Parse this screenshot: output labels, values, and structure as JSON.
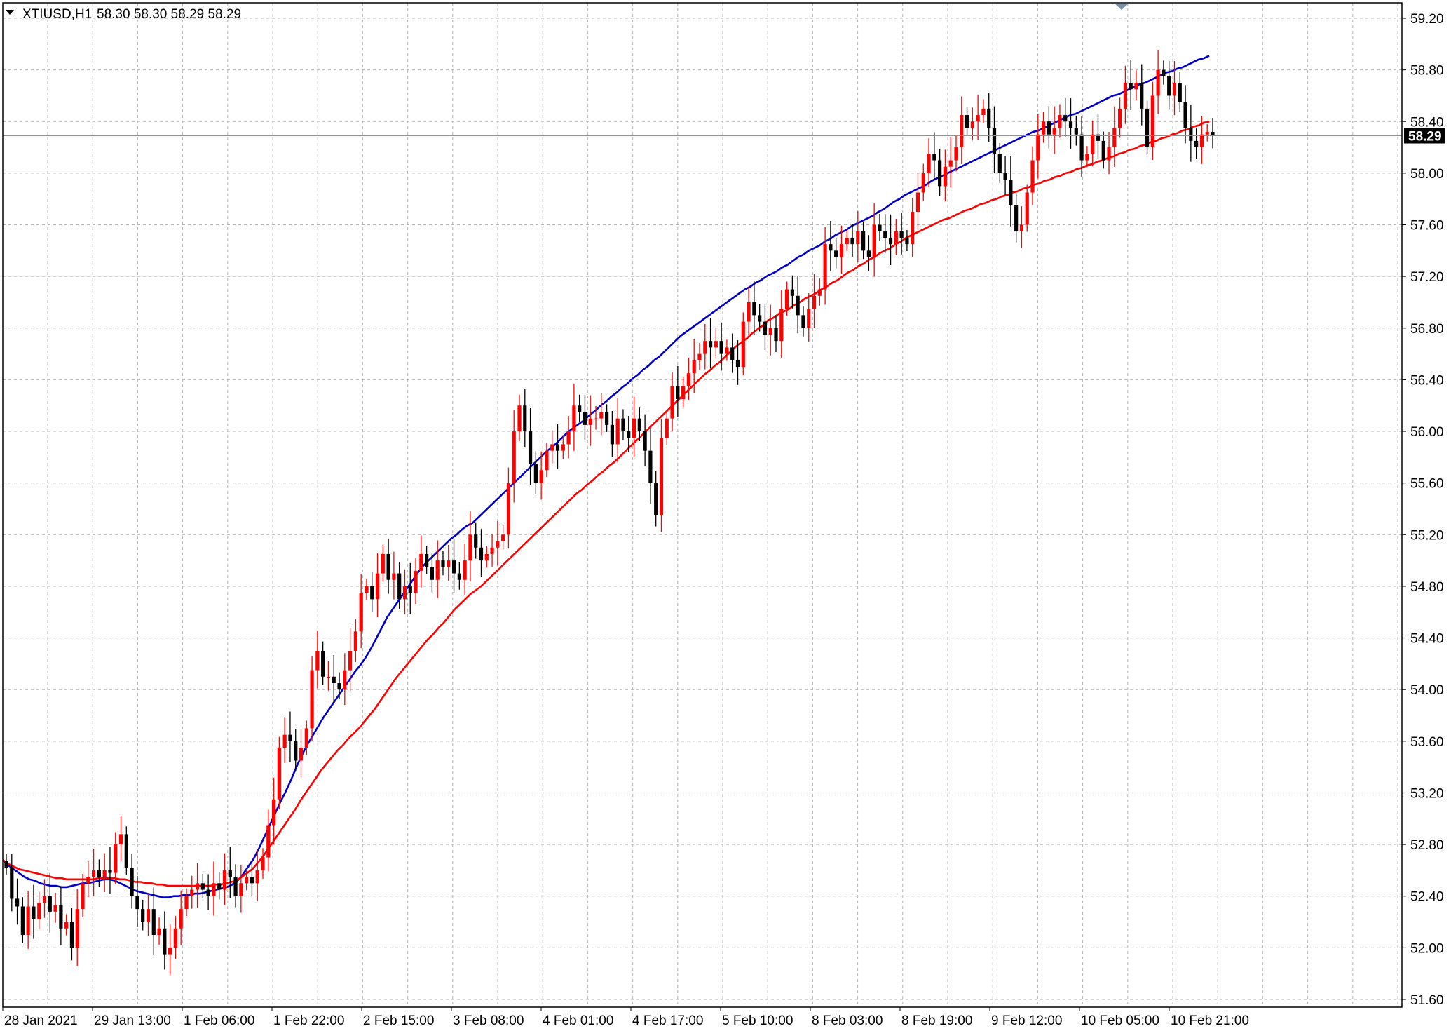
{
  "header": {
    "symbol": "XTIUSD,H1",
    "ohlc": "58.30 58.30 58.29 58.29",
    "collapse_icon": "triangle-down-icon"
  },
  "colors": {
    "background": "#ffffff",
    "grid": "#b4b4b4",
    "bull_candle": "#ff0000",
    "bear_candle": "#000000",
    "ma_fast": "#0000c8",
    "ma_slow": "#ff0000",
    "bid_line": "#8090b0",
    "price_tag_bg": "#000000"
  },
  "current_price_label": "58.29",
  "chart_data": {
    "type": "candlestick",
    "title": "XTIUSD,H1",
    "y_ticks": [
      "59.20",
      "58.80",
      "58.40",
      "58.00",
      "57.60",
      "57.20",
      "56.80",
      "56.40",
      "56.00",
      "55.60",
      "55.20",
      "54.80",
      "54.40",
      "54.00",
      "53.60",
      "53.20",
      "52.80",
      "52.40",
      "52.00",
      "51.60"
    ],
    "x_ticks": [
      "28 Jan 2021",
      "29 Jan 13:00",
      "1 Feb 06:00",
      "1 Feb 22:00",
      "2 Feb 15:00",
      "3 Feb 08:00",
      "4 Feb 01:00",
      "4 Feb 17:00",
      "5 Feb 10:00",
      "8 Feb 03:00",
      "8 Feb 19:00",
      "9 Feb 12:00",
      "10 Feb 05:00",
      "10 Feb 21:00"
    ],
    "ylim": [
      51.45,
      59.3
    ],
    "grid": true,
    "last_price": 58.29,
    "close": [
      52.62,
      52.38,
      52.32,
      52.1,
      52.32,
      52.22,
      52.35,
      52.4,
      52.28,
      52.33,
      52.15,
      52.2,
      52.0,
      52.3,
      52.5,
      52.55,
      52.6,
      52.55,
      52.6,
      52.58,
      52.8,
      52.88,
      52.62,
      52.4,
      52.3,
      52.2,
      52.3,
      52.1,
      52.15,
      51.95,
      52.0,
      52.15,
      52.3,
      52.4,
      52.45,
      52.5,
      52.45,
      52.4,
      52.5,
      52.45,
      52.6,
      52.55,
      52.4,
      52.5,
      52.55,
      52.5,
      52.6,
      52.7,
      52.95,
      53.15,
      53.55,
      53.65,
      53.6,
      53.45,
      53.55,
      53.7,
      54.15,
      54.3,
      54.1,
      54.1,
      54.05,
      54.0,
      54.15,
      54.3,
      54.45,
      54.75,
      54.8,
      54.7,
      54.9,
      55.05,
      54.85,
      54.9,
      54.7,
      54.8,
      54.75,
      54.92,
      55.05,
      54.95,
      54.85,
      55.0,
      54.95,
      55.0,
      54.9,
      54.85,
      55.0,
      55.2,
      55.1,
      55.0,
      55.05,
      55.1,
      55.15,
      55.2,
      55.6,
      56.0,
      56.2,
      56.0,
      55.75,
      55.6,
      55.7,
      55.85,
      55.9,
      55.85,
      55.9,
      56.0,
      56.2,
      56.15,
      56.05,
      56.1,
      56.1,
      56.15,
      56.05,
      55.9,
      56.1,
      56.0,
      55.95,
      56.1,
      56.0,
      55.85,
      55.6,
      55.35,
      55.95,
      56.1,
      56.35,
      56.25,
      56.35,
      56.45,
      56.55,
      56.6,
      56.7,
      56.65,
      56.7,
      56.6,
      56.65,
      56.55,
      56.5,
      56.85,
      57.0,
      56.9,
      56.85,
      56.75,
      56.8,
      56.7,
      56.95,
      57.1,
      57.05,
      56.9,
      56.8,
      56.95,
      57.05,
      57.1,
      57.45,
      57.4,
      57.35,
      57.45,
      57.5,
      57.45,
      57.55,
      57.4,
      57.35,
      57.6,
      57.55,
      57.5,
      57.45,
      57.55,
      57.5,
      57.45,
      57.7,
      57.85,
      58.0,
      58.15,
      58.1,
      57.9,
      58.05,
      58.1,
      58.2,
      58.45,
      58.35,
      58.4,
      58.45,
      58.5,
      58.35,
      58.15,
      58.0,
      57.95,
      57.75,
      57.55,
      57.6,
      57.85,
      58.1,
      58.3,
      58.4,
      58.3,
      58.35,
      58.45,
      58.4,
      58.35,
      58.3,
      58.1,
      58.15,
      58.3,
      58.25,
      58.1,
      58.2,
      58.35,
      58.5,
      58.7,
      58.65,
      58.7,
      58.5,
      58.2,
      58.6,
      58.8,
      58.75,
      58.6,
      58.7,
      58.55,
      58.35,
      58.25,
      58.2,
      58.3,
      58.32,
      58.29
    ],
    "series": [
      {
        "values": [
          52.68,
          52.64,
          52.61,
          52.58,
          52.55,
          52.53,
          52.52,
          52.5,
          52.49,
          52.48,
          52.48,
          52.47,
          52.47,
          52.48,
          52.49,
          52.5,
          52.5,
          52.51,
          52.52,
          52.53,
          52.53,
          52.52,
          52.5,
          52.48,
          52.46,
          52.44,
          52.43,
          52.42,
          52.41,
          52.4,
          52.39,
          52.39,
          52.4,
          52.4,
          52.41,
          52.41,
          52.42,
          52.42,
          52.43,
          52.44,
          52.45,
          52.46,
          52.47,
          52.49,
          52.52,
          52.57,
          52.63,
          52.69,
          52.77,
          52.86,
          52.95,
          53.04,
          53.13,
          53.21,
          53.3,
          53.4,
          53.49,
          53.57,
          53.64,
          53.71,
          53.78,
          53.84,
          53.9,
          53.96,
          54.02,
          54.08,
          54.14,
          54.19,
          54.25,
          54.32,
          54.4,
          54.48,
          54.56,
          54.62,
          54.68,
          54.74,
          54.8,
          54.86,
          54.92,
          54.97,
          55.01,
          55.05,
          55.09,
          55.13,
          55.17,
          55.2,
          55.24,
          55.27,
          55.29,
          55.33,
          55.37,
          55.41,
          55.45,
          55.49,
          55.53,
          55.57,
          55.61,
          55.65,
          55.69,
          55.73,
          55.77,
          55.81,
          55.85,
          55.88,
          55.92,
          55.96,
          56.0,
          56.03,
          56.06,
          56.09,
          56.13,
          56.16,
          56.2,
          56.23,
          56.27,
          56.3,
          56.34,
          56.37,
          56.41,
          56.44,
          56.48,
          56.51,
          56.55,
          56.58,
          56.62,
          56.66,
          56.7,
          56.74,
          56.77,
          56.8,
          56.83,
          56.86,
          56.89,
          56.92,
          56.95,
          56.98,
          57.01,
          57.04,
          57.07,
          57.1,
          57.12,
          57.15,
          57.17,
          57.2,
          57.22,
          57.24,
          57.27,
          57.29,
          57.32,
          57.35,
          57.37,
          57.4,
          57.42,
          57.44,
          57.47,
          57.49,
          57.52,
          57.54,
          57.56,
          57.59,
          57.61,
          57.63,
          57.65,
          57.67,
          57.7,
          57.72,
          57.75,
          57.78,
          57.8,
          57.83,
          57.85,
          57.87,
          57.89,
          57.91,
          57.94,
          57.96,
          57.98,
          58.0,
          58.02,
          58.04,
          58.06,
          58.08,
          58.1,
          58.12,
          58.14,
          58.16,
          58.18,
          58.2,
          58.22,
          58.24,
          58.26,
          58.28,
          58.3,
          58.32,
          58.33,
          58.35,
          58.37,
          58.39,
          58.41,
          58.43,
          58.45,
          58.46,
          58.48,
          58.5,
          58.52,
          58.54,
          58.56,
          58.58,
          58.6,
          58.61,
          58.63,
          58.65,
          58.67,
          58.69,
          58.7,
          58.72,
          58.74,
          58.76,
          58.78,
          58.79,
          58.81,
          58.82,
          58.84,
          58.86,
          58.88,
          58.89,
          58.91
        ]
      },
      {
        "values": [
          52.68,
          52.65,
          52.63,
          52.61,
          52.6,
          52.59,
          52.58,
          52.57,
          52.56,
          52.55,
          52.54,
          52.54,
          52.53,
          52.53,
          52.53,
          52.53,
          52.53,
          52.53,
          52.54,
          52.54,
          52.54,
          52.54,
          52.53,
          52.53,
          52.52,
          52.51,
          52.51,
          52.5,
          52.5,
          52.49,
          52.49,
          52.48,
          52.48,
          52.48,
          52.48,
          52.48,
          52.48,
          52.48,
          52.48,
          52.48,
          52.49,
          52.49,
          52.5,
          52.51,
          52.52,
          52.55,
          52.58,
          52.61,
          52.66,
          52.71,
          52.77,
          52.83,
          52.89,
          52.95,
          53.01,
          53.07,
          53.14,
          53.2,
          53.26,
          53.32,
          53.38,
          53.43,
          53.48,
          53.53,
          53.57,
          53.62,
          53.66,
          53.7,
          53.75,
          53.8,
          53.85,
          53.91,
          53.97,
          54.03,
          54.09,
          54.14,
          54.19,
          54.24,
          54.29,
          54.34,
          54.39,
          54.43,
          54.48,
          54.52,
          54.57,
          54.62,
          54.66,
          54.7,
          54.74,
          54.77,
          54.8,
          54.84,
          54.88,
          54.92,
          54.96,
          55.0,
          55.04,
          55.08,
          55.12,
          55.16,
          55.2,
          55.24,
          55.28,
          55.32,
          55.36,
          55.4,
          55.44,
          55.48,
          55.52,
          55.55,
          55.59,
          55.62,
          55.66,
          55.69,
          55.73,
          55.76,
          55.8,
          55.84,
          55.88,
          55.92,
          55.96,
          56.0,
          56.04,
          56.08,
          56.12,
          56.16,
          56.2,
          56.24,
          56.28,
          56.32,
          56.36,
          56.4,
          56.44,
          56.47,
          56.51,
          56.54,
          56.58,
          56.62,
          56.66,
          56.69,
          56.72,
          56.76,
          56.79,
          56.82,
          56.86,
          56.88,
          56.91,
          56.93,
          56.95,
          56.98,
          57.0,
          57.03,
          57.05,
          57.07,
          57.1,
          57.12,
          57.15,
          57.17,
          57.2,
          57.23,
          57.25,
          57.28,
          57.3,
          57.33,
          57.35,
          57.38,
          57.4,
          57.42,
          57.45,
          57.47,
          57.5,
          57.52,
          57.54,
          57.56,
          57.58,
          57.6,
          57.62,
          57.64,
          57.65,
          57.67,
          57.69,
          57.71,
          57.72,
          57.74,
          57.76,
          57.77,
          57.79,
          57.8,
          57.82,
          57.83,
          57.85,
          57.86,
          57.88,
          57.89,
          57.91,
          57.92,
          57.94,
          57.95,
          57.97,
          57.98,
          58.0,
          58.01,
          58.03,
          58.04,
          58.06,
          58.07,
          58.09,
          58.1,
          58.12,
          58.13,
          58.15,
          58.16,
          58.18,
          58.19,
          58.21,
          58.22,
          58.24,
          58.25,
          58.27,
          58.28,
          58.3,
          58.31,
          58.33,
          58.34,
          58.36,
          58.37,
          58.39,
          58.4
        ]
      }
    ]
  }
}
